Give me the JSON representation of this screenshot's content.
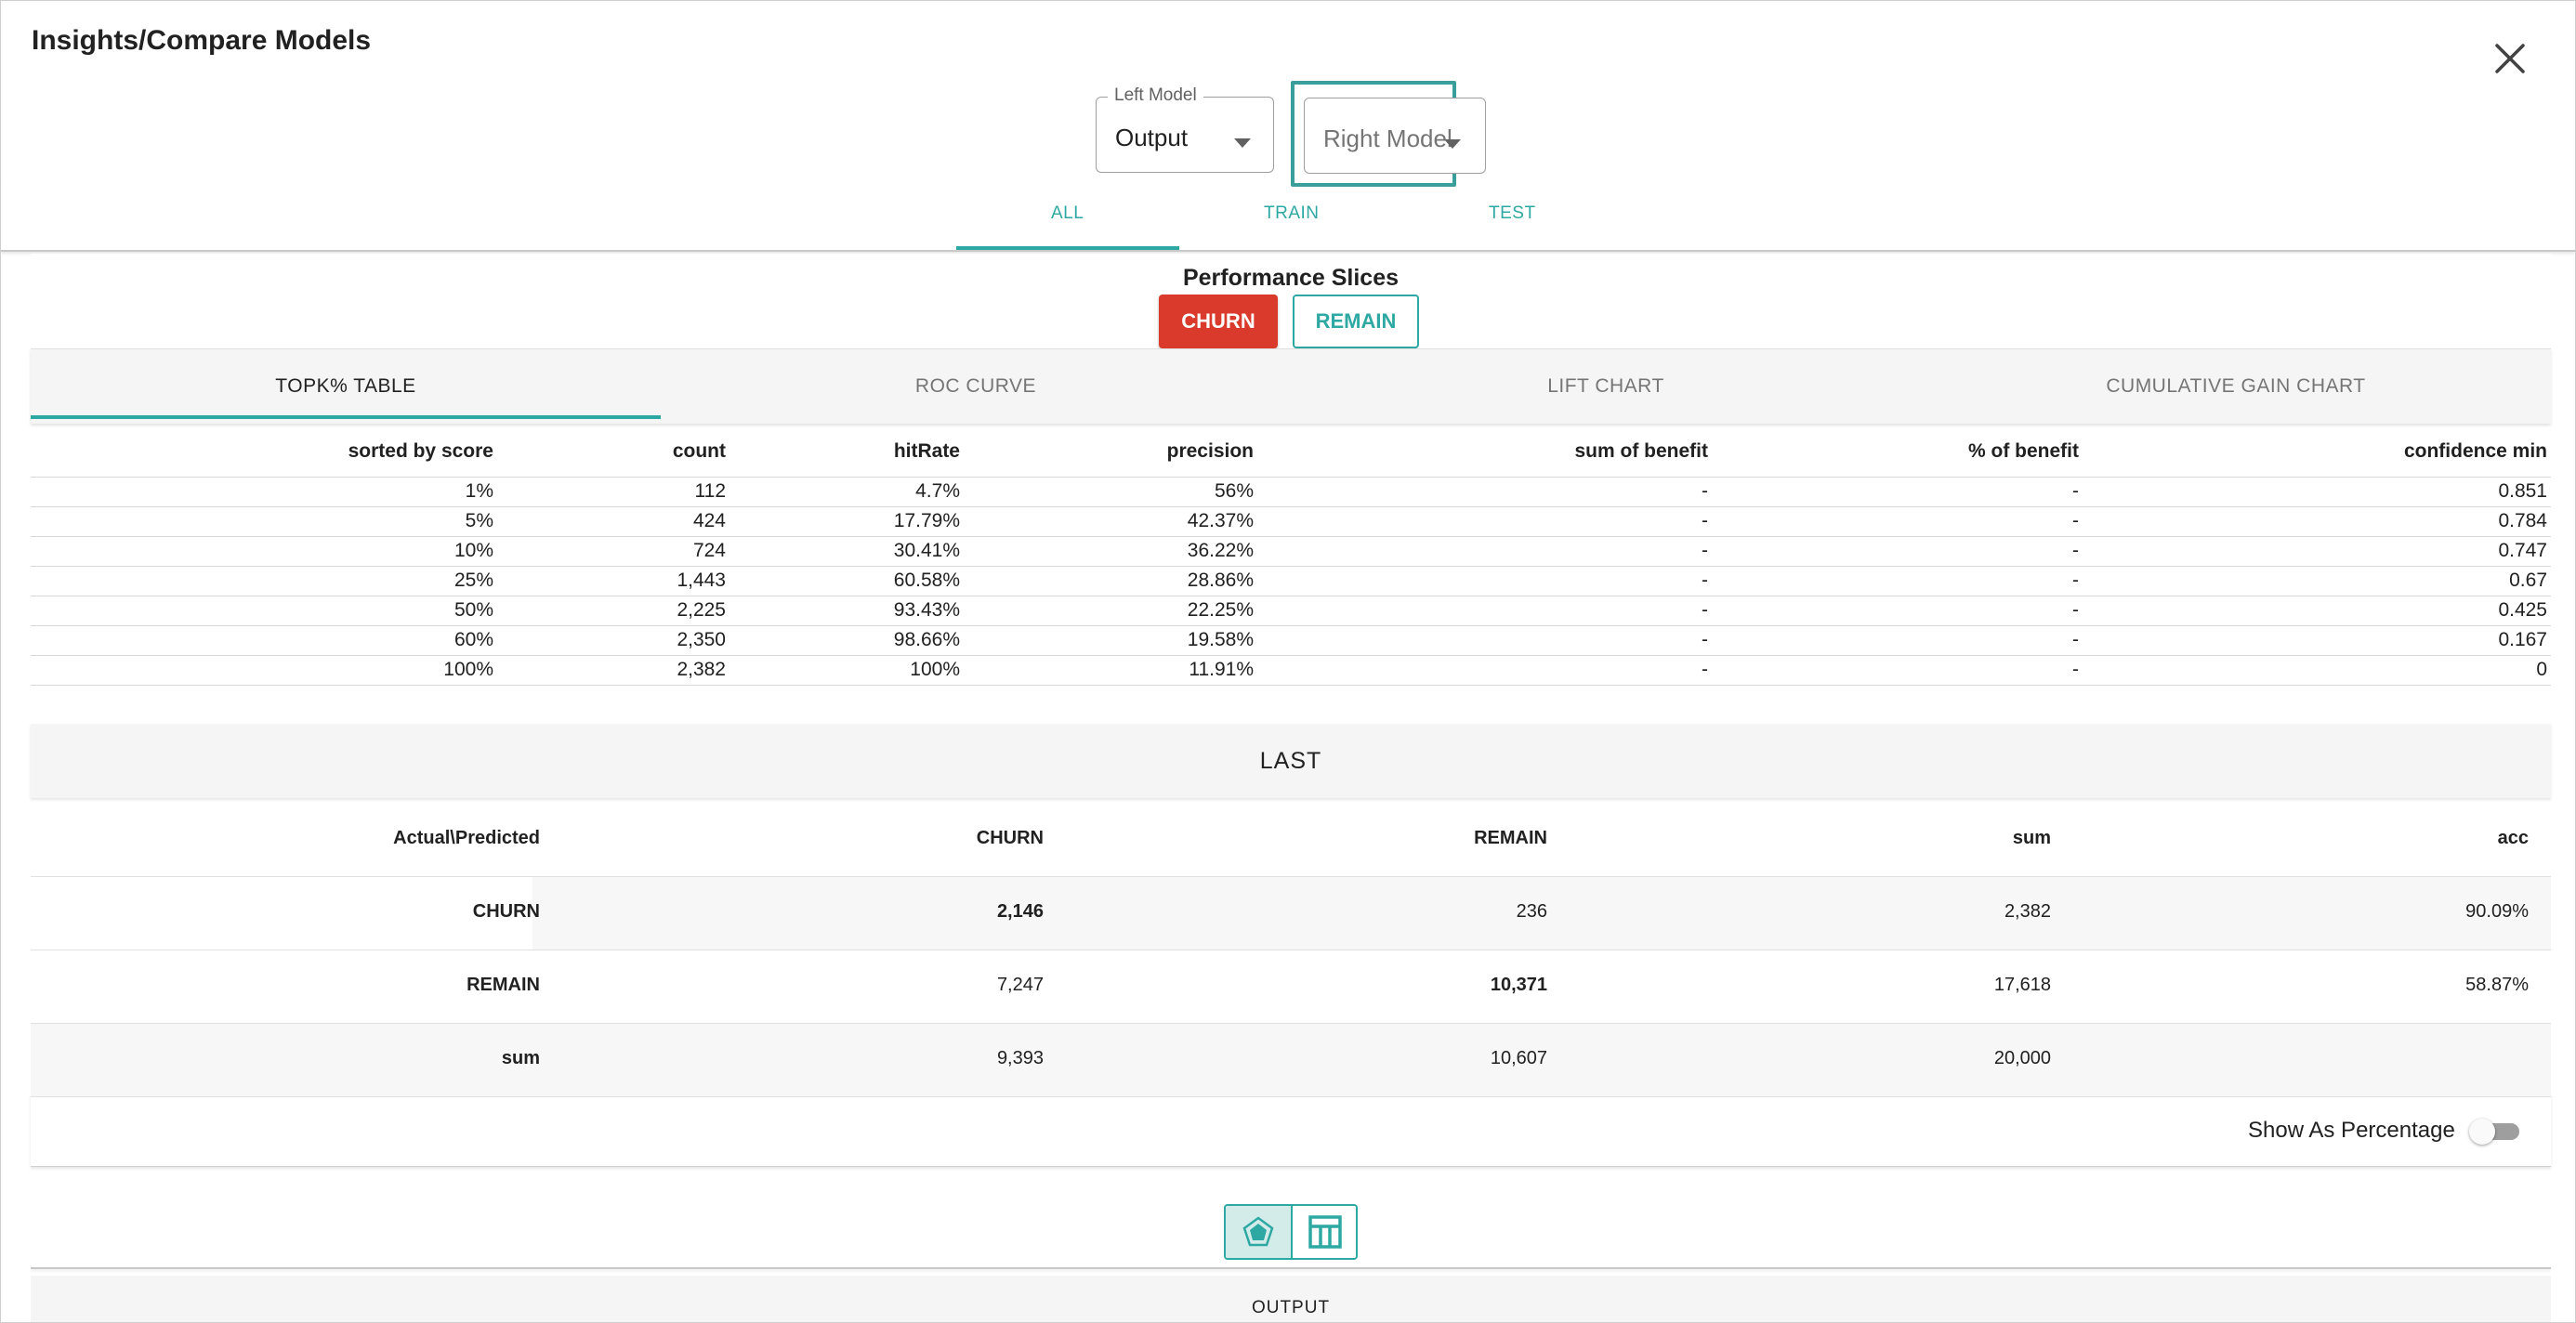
{
  "dialog": {
    "title": "Insights/Compare Models"
  },
  "model_selectors": {
    "left_label": "Left Model",
    "left_value": "Output",
    "right_placeholder": "Right Model"
  },
  "top_tabs": [
    {
      "label": "ALL",
      "active": true
    },
    {
      "label": "TRAIN",
      "active": false
    },
    {
      "label": "TEST",
      "active": false
    }
  ],
  "performance": {
    "title": "Performance Slices",
    "churn_label": "CHURN",
    "remain_label": "REMAIN"
  },
  "sub_tabs": [
    {
      "label": "TOPK% TABLE",
      "active": true
    },
    {
      "label": "ROC CURVE",
      "active": false
    },
    {
      "label": "LIFT CHART",
      "active": false
    },
    {
      "label": "CUMULATIVE GAIN CHART",
      "active": false
    }
  ],
  "topk_table": {
    "headers": [
      "sorted by score",
      "count",
      "hitRate",
      "precision",
      "sum of benefit",
      "% of benefit",
      "confidence min"
    ],
    "rows": [
      [
        "1%",
        "112",
        "4.7%",
        "56%",
        "-",
        "-",
        "0.851"
      ],
      [
        "5%",
        "424",
        "17.79%",
        "42.37%",
        "-",
        "-",
        "0.784"
      ],
      [
        "10%",
        "724",
        "30.41%",
        "36.22%",
        "-",
        "-",
        "0.747"
      ],
      [
        "25%",
        "1,443",
        "60.58%",
        "28.86%",
        "-",
        "-",
        "0.67"
      ],
      [
        "50%",
        "2,225",
        "93.43%",
        "22.25%",
        "-",
        "-",
        "0.425"
      ],
      [
        "60%",
        "2,350",
        "98.66%",
        "19.58%",
        "-",
        "-",
        "0.167"
      ],
      [
        "100%",
        "2,382",
        "100%",
        "11.91%",
        "-",
        "-",
        "0"
      ]
    ]
  },
  "confusion": {
    "section_title": "LAST",
    "headers": [
      "Actual\\Predicted",
      "CHURN",
      "REMAIN",
      "sum",
      "acc"
    ],
    "rows": [
      [
        "CHURN",
        "2,146",
        "236",
        "2,382",
        "90.09%"
      ],
      [
        "REMAIN",
        "7,247",
        "10,371",
        "17,618",
        "58.87%"
      ],
      [
        "sum",
        "9,393",
        "10,607",
        "20,000",
        ""
      ]
    ],
    "show_as_percentage_label": "Show As Percentage",
    "show_as_percentage_on": false
  },
  "view_toggle": {
    "icons": [
      "pentagon-chart-icon",
      "table-icon"
    ]
  },
  "output": {
    "label": "OUTPUT"
  },
  "colors": {
    "accent": "#2ea8a3",
    "churn": "#d93a2b"
  }
}
